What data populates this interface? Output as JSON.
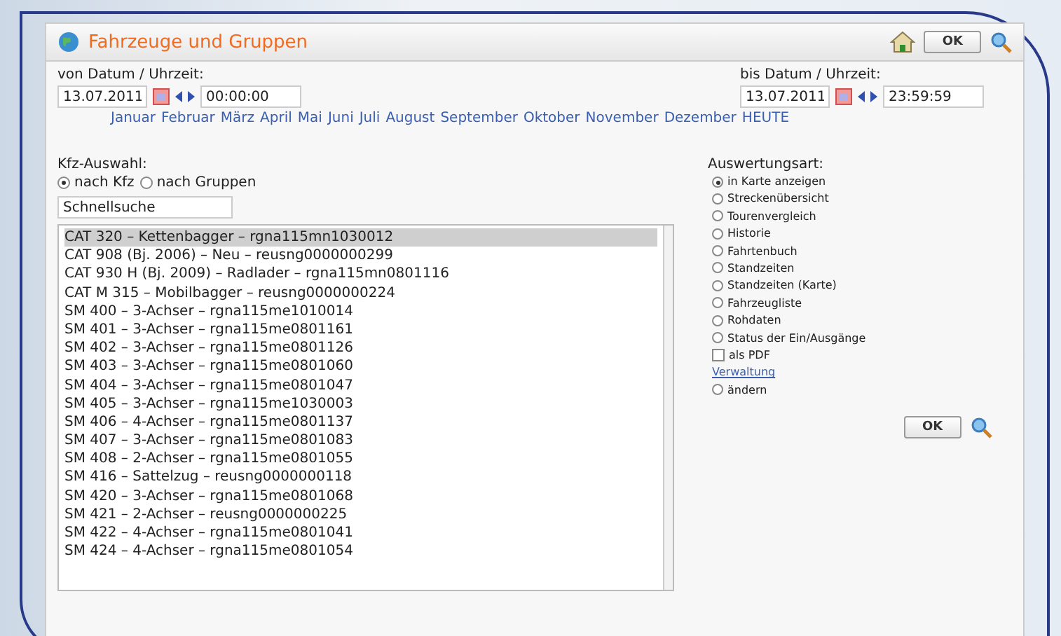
{
  "window": {
    "title": "Fahrzeuge und Gruppen",
    "ok_button": "OK"
  },
  "from": {
    "label": "von Datum / Uhrzeit:",
    "date": "13.07.2011",
    "time": "00:00:00"
  },
  "to": {
    "label": "bis Datum / Uhrzeit:",
    "date": "13.07.2011",
    "time": "23:59:59"
  },
  "months": [
    "Januar",
    "Februar",
    "März",
    "April",
    "Mai",
    "Juni",
    "Juli",
    "August",
    "September",
    "Oktober",
    "November",
    "Dezember"
  ],
  "today_link": "HEUTE",
  "vehicle_selection": {
    "label": "Kfz-Auswahl:",
    "modes": [
      {
        "label": "nach Kfz",
        "selected": true
      },
      {
        "label": "nach Gruppen",
        "selected": false
      }
    ],
    "search_value": "Schnellsuche",
    "items": [
      {
        "label": "CAT 320 – Kettenbagger – rgna115mn1030012",
        "selected": true
      },
      {
        "label": "CAT 908 (Bj. 2006) – Neu – reusng0000000299",
        "selected": false
      },
      {
        "label": "CAT 930 H (Bj. 2009) – Radlader – rgna115mn0801116",
        "selected": false
      },
      {
        "label": "CAT M 315 – Mobilbagger – reusng0000000224",
        "selected": false
      },
      {
        "label": "SM 400 – 3-Achser – rgna115me1010014",
        "selected": false
      },
      {
        "label": "SM 401 – 3-Achser – rgna115me0801161",
        "selected": false
      },
      {
        "label": "SM 402 – 3-Achser – rgna115me0801126",
        "selected": false
      },
      {
        "label": "SM 403 – 3-Achser – rgna115me0801060",
        "selected": false
      },
      {
        "label": "SM 404 – 3-Achser – rgna115me0801047",
        "selected": false
      },
      {
        "label": "SM 405 – 3-Achser – rgna115me1030003",
        "selected": false
      },
      {
        "label": "SM 406 – 4-Achser – rgna115me0801137",
        "selected": false
      },
      {
        "label": "SM 407 – 3-Achser – rgna115me0801083",
        "selected": false
      },
      {
        "label": "SM 408 – 2-Achser – rgna115me0801055",
        "selected": false
      },
      {
        "label": "SM 416 – Sattelzug – reusng0000000118",
        "selected": false
      },
      {
        "label": "SM 420 – 3-Achser – rgna115me0801068",
        "selected": false
      },
      {
        "label": "SM 421 – 2-Achser – reusng0000000225",
        "selected": false
      },
      {
        "label": "SM 422 – 4-Achser – rgna115me0801041",
        "selected": false
      },
      {
        "label": "SM 424 – 4-Achser – rgna115me0801054",
        "selected": false
      }
    ]
  },
  "evaluation": {
    "label": "Auswertungsart:",
    "options": [
      {
        "label": "in Karte anzeigen",
        "selected": true
      },
      {
        "label": "Streckenübersicht",
        "selected": false
      },
      {
        "label": "Tourenvergleich",
        "selected": false
      },
      {
        "label": "Historie",
        "selected": false
      },
      {
        "label": "Fahrtenbuch",
        "selected": false
      },
      {
        "label": "Standzeiten",
        "selected": false
      },
      {
        "label": "Standzeiten (Karte)",
        "selected": false
      },
      {
        "label": "Fahrzeugliste",
        "selected": false
      },
      {
        "label": "Rohdaten",
        "selected": false
      },
      {
        "label": "Status der Ein/Ausgänge",
        "selected": false
      }
    ],
    "pdf": {
      "label": "als PDF",
      "checked": false
    },
    "admin_link": "Verwaltung",
    "admin_options": [
      {
        "label": "ändern",
        "selected": false
      }
    ],
    "ok_button": "OK"
  }
}
